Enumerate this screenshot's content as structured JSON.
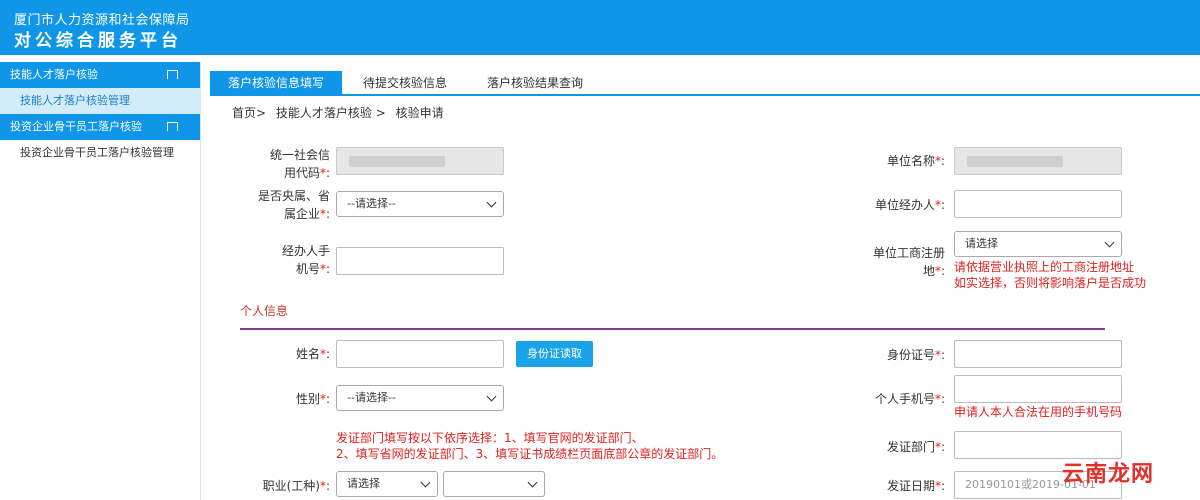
{
  "header": {
    "org_name": "厦门市人力资源和社会保障局",
    "platform_name": "对公综合服务平台"
  },
  "sidebar": {
    "groups": [
      {
        "label": "技能人才落户核验",
        "items": [
          "技能人才落户核验管理"
        ]
      },
      {
        "label": "投资企业骨干员工落户核验",
        "items": [
          "投资企业骨干员工落户核验管理"
        ]
      }
    ]
  },
  "tabs": [
    "落户核验信息填写",
    "待提交核验信息",
    "落户核验结果查询"
  ],
  "breadcrumb": [
    "首页>",
    "技能人才落户核验 >",
    "核验申请"
  ],
  "form": {
    "credit_code_label_1": "统一社会信",
    "credit_code_label_2": "用代码",
    "unit_name_label": "单位名称",
    "central_label_1": "是否央属、省",
    "central_label_2": "属企业",
    "central_select": "--请选择--",
    "unit_handler_label": "单位经办人",
    "handler_phone_label_1": "经办人手",
    "handler_phone_label_2": "机号",
    "reg_addr_label_1": "单位工商注册",
    "reg_addr_label_2": "地",
    "reg_addr_select": "请选择",
    "reg_addr_hint_1": "请依据营业执照上的工商注册地址",
    "reg_addr_hint_2": "如实选择，否则将影响落户是否成功"
  },
  "personal": {
    "section_title": "个人信息",
    "name_label": "姓名",
    "scan_button": "身份证读取",
    "id_label": "身份证号",
    "gender_label": "性别",
    "gender_select": "--请选择--",
    "phone_label": "个人手机号",
    "phone_hint": "申请人本人合法在用的手机号码",
    "issuer_hint_1": "发证部门填写按以下依序选择：1、填写官网的发证部门、",
    "issuer_hint_2": "2、填写省网的发证部门、3、填写证书成绩栏页面底部公章的发证部门。",
    "issuer_label": "发证部门",
    "occupation_label": "职业(工种)",
    "occupation_select": "请选择",
    "issue_date_label": "发证日期",
    "issue_date_placeholder": "20190101或2019-01-01"
  },
  "required_mark": "*",
  "colon": ":",
  "watermark": "云南龙网"
}
